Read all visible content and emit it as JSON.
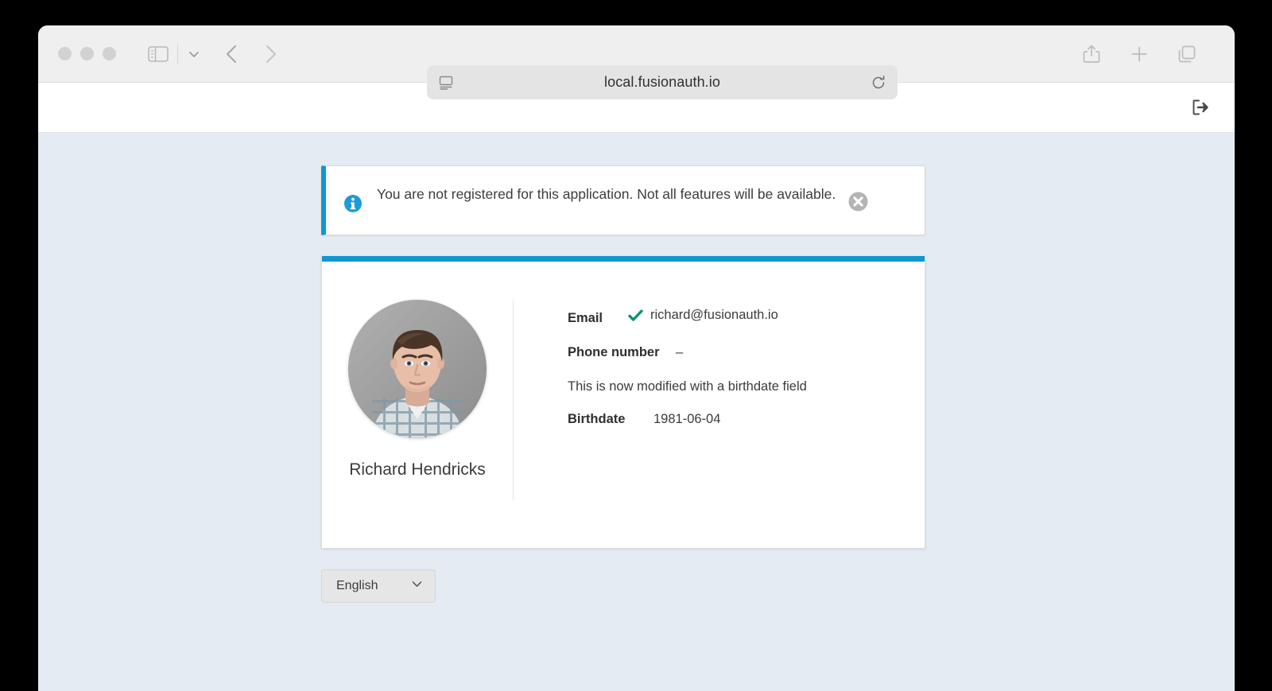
{
  "browser": {
    "url": "local.fusionauth.io",
    "traffic_lights": [
      "close",
      "minimize",
      "maximize"
    ],
    "icons": {
      "sidebar": "sidebar-toggle-icon",
      "sidebar_menu": "chevron-down-icon",
      "back": "back-chevron-icon",
      "forward": "forward-chevron-icon",
      "reader": "reader-view-icon",
      "reload": "reload-icon",
      "share": "share-icon",
      "new_tab": "plus-icon",
      "tab_overview": "tab-overview-icon"
    }
  },
  "app_header": {
    "logout_icon": "logout-icon"
  },
  "alert": {
    "icon": "info-icon",
    "message": "You are not registered for this application. Not all features will be available.",
    "close_icon": "close-circle-icon",
    "accent_color": "#0e97d1",
    "icon_color": "#1e9bd7"
  },
  "profile": {
    "accent_color": "#0e97d1",
    "avatar_alt": "Richard Hendricks profile photo",
    "name": "Richard Hendricks",
    "details": [
      {
        "label": "Email",
        "value": "richard@fusionauth.io",
        "verified": true
      },
      {
        "label": "Phone number",
        "value": "–",
        "verified": false
      }
    ],
    "note": "This is now modified with a birthdate field",
    "birthdate_label": "Birthdate",
    "birthdate_value": "1981-06-04",
    "verified_color": "#0e9373"
  },
  "language": {
    "selected": "English",
    "chevron_icon": "chevron-down-icon"
  }
}
